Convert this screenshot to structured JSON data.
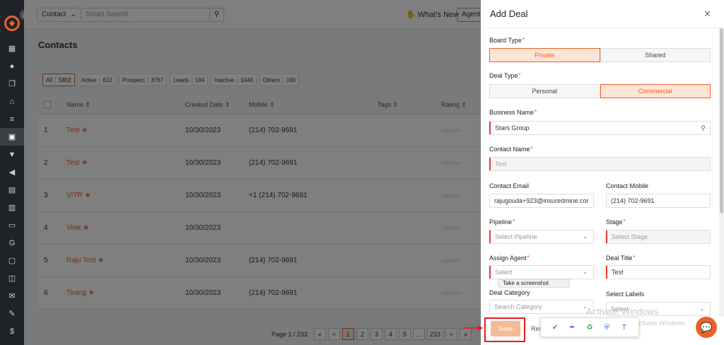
{
  "topbar": {
    "contact_select": "Contact",
    "search_placeholder": "Smart Search",
    "whats_new": "What's New",
    "agent": "Agent"
  },
  "page": {
    "title": "Contacts",
    "filters": [
      {
        "label": "All",
        "count": "5802"
      },
      {
        "label": "Active",
        "count": "612"
      },
      {
        "label": "Prospect",
        "count": "3767"
      },
      {
        "label": "Leads",
        "count": "184"
      },
      {
        "label": "Inactive",
        "count": "1046"
      },
      {
        "label": "Others",
        "count": "193"
      }
    ],
    "columns": [
      "Name",
      "Created Date",
      "Mobile",
      "Tags",
      "Rating"
    ],
    "rows": [
      {
        "num": "1",
        "name": "Test",
        "date": "10/30/2023",
        "mobile": "(214) 702-9691"
      },
      {
        "num": "2",
        "name": "Test",
        "date": "10/30/2023",
        "mobile": "(214) 702-9691"
      },
      {
        "num": "3",
        "name": "VITR",
        "date": "10/30/2023",
        "mobile": "+1 (214) 702-9691"
      },
      {
        "num": "4",
        "name": "Virat",
        "date": "10/30/2023",
        "mobile": ""
      },
      {
        "num": "5",
        "name": "Raju Test",
        "date": "10/30/2023",
        "mobile": "(214) 702-9691"
      },
      {
        "num": "6",
        "name": "Tirang",
        "date": "10/30/2023",
        "mobile": "(214) 702-9691"
      }
    ],
    "pager": {
      "info": "Page 1 / 233",
      "buttons": [
        "«",
        "<",
        "1",
        "2",
        "3",
        "4",
        "5",
        "...",
        "233",
        ">",
        "»"
      ]
    }
  },
  "panel": {
    "title": "Add Deal",
    "board_type": {
      "label": "Board Type",
      "options": [
        "Private",
        "Shared"
      ],
      "selected": "Private"
    },
    "deal_type": {
      "label": "Deal Type",
      "options": [
        "Personal",
        "Commercial"
      ],
      "selected": "Commercial"
    },
    "business_name": {
      "label": "Business Name",
      "value": "Stars Group"
    },
    "contact_name": {
      "label": "Contact Name",
      "value": "Test"
    },
    "contact_email": {
      "label": "Contact Email",
      "value": "rajugouda+923@insuredmine.cor"
    },
    "contact_mobile": {
      "label": "Contact Mobile",
      "value": "(214) 702-9691"
    },
    "pipeline": {
      "label": "Pipeline",
      "placeholder": "Select Pipeline"
    },
    "stage": {
      "label": "Stage",
      "placeholder": "Select Stage"
    },
    "assign_agent": {
      "label": "Assign Agent",
      "placeholder": "Select"
    },
    "deal_title": {
      "label": "Deal Title",
      "value": "Test"
    },
    "deal_category": {
      "label": "Deal Category",
      "placeholder": "Search Category"
    },
    "select_labels": {
      "label": "Select Labels",
      "placeholder": "Select"
    },
    "tooltip": "Take a screenshot",
    "save": "Save",
    "reset": "Res"
  },
  "windows": {
    "activate_title": "Activate Windows",
    "activate_sub": "Go to Settings to activate Windows."
  },
  "colors": {
    "accent": "#e8622a",
    "required": "#e53935"
  }
}
